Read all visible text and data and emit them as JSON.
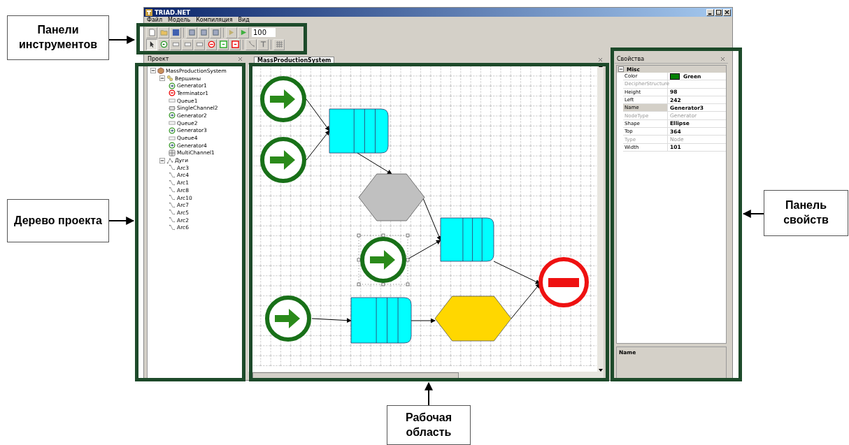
{
  "window": {
    "title": "TRIAD.NET"
  },
  "menu": [
    "Файл",
    "Модель",
    "Компиляция",
    "Вид"
  ],
  "toolbar": {
    "zoom_value": "100"
  },
  "project_panel": {
    "title": "Проект",
    "tree": [
      {
        "label": "MassProductionSystem",
        "kind": "model",
        "expanded": true,
        "children": [
          {
            "label": "Вершины",
            "kind": "nodes",
            "expanded": true,
            "children": [
              {
                "label": "Generator1",
                "kind": "generator"
              },
              {
                "label": "Terminator1",
                "kind": "terminator"
              },
              {
                "label": "Queue1",
                "kind": "queue"
              },
              {
                "label": "SingleChannel2",
                "kind": "channel"
              },
              {
                "label": "Generator2",
                "kind": "generator"
              },
              {
                "label": "Queue2",
                "kind": "queue"
              },
              {
                "label": "Generator3",
                "kind": "generator"
              },
              {
                "label": "Queue4",
                "kind": "queue"
              },
              {
                "label": "Generator4",
                "kind": "generator"
              },
              {
                "label": "MultiChannel1",
                "kind": "multichannel"
              }
            ]
          },
          {
            "label": "Дуги",
            "kind": "arcs",
            "expanded": true,
            "children": [
              {
                "label": "Arc3",
                "kind": "arc"
              },
              {
                "label": "Arc4",
                "kind": "arc"
              },
              {
                "label": "Arc1",
                "kind": "arc"
              },
              {
                "label": "Arc8",
                "kind": "arc"
              },
              {
                "label": "Arc10",
                "kind": "arc"
              },
              {
                "label": "Arc7",
                "kind": "arc"
              },
              {
                "label": "Arc5",
                "kind": "arc"
              },
              {
                "label": "Arc2",
                "kind": "arc"
              },
              {
                "label": "Arc6",
                "kind": "arc"
              }
            ]
          }
        ]
      }
    ]
  },
  "document_tab": {
    "label": "MassProductionSystem"
  },
  "diagram": {
    "nodes": [
      {
        "kind": "generator",
        "selected": false
      },
      {
        "kind": "generator",
        "selected": false
      },
      {
        "kind": "queue",
        "selected": false
      },
      {
        "kind": "channel",
        "selected": false,
        "color": "#c0c0c0"
      },
      {
        "kind": "generator",
        "selected": true
      },
      {
        "kind": "queue",
        "selected": false
      },
      {
        "kind": "terminator",
        "selected": false
      },
      {
        "kind": "generator",
        "selected": false
      },
      {
        "kind": "queue",
        "selected": false
      },
      {
        "kind": "channel",
        "selected": false,
        "color": "#ffd700"
      }
    ]
  },
  "properties_panel": {
    "title": "Свойства",
    "category": "Misc",
    "rows": [
      {
        "name": "Color",
        "value": "Green",
        "disabled": false,
        "selected": false,
        "color": "#008000"
      },
      {
        "name": "DecipherStructure",
        "value": "",
        "disabled": true,
        "selected": false
      },
      {
        "name": "Height",
        "value": "98",
        "disabled": false,
        "selected": false
      },
      {
        "name": "Left",
        "value": "242",
        "disabled": false,
        "selected": false
      },
      {
        "name": "Name",
        "value": "Generator3",
        "disabled": false,
        "selected": true
      },
      {
        "name": "NodeType",
        "value": "Generator",
        "disabled": true,
        "selected": false
      },
      {
        "name": "Shape",
        "value": "Ellipse",
        "disabled": false,
        "selected": false
      },
      {
        "name": "Top",
        "value": "364",
        "disabled": false,
        "selected": false
      },
      {
        "name": "Type",
        "value": "Node",
        "disabled": true,
        "selected": false
      },
      {
        "name": "Width",
        "value": "101",
        "disabled": false,
        "selected": false
      }
    ],
    "description_title": "Name"
  },
  "annotations": [
    {
      "kind": "toolbars",
      "text": "Панели инструментов"
    },
    {
      "kind": "tree",
      "text": "Дерево проекта"
    },
    {
      "kind": "workspace",
      "text": "Рабочая область"
    },
    {
      "kind": "properties",
      "text": "Панель свойств"
    }
  ]
}
